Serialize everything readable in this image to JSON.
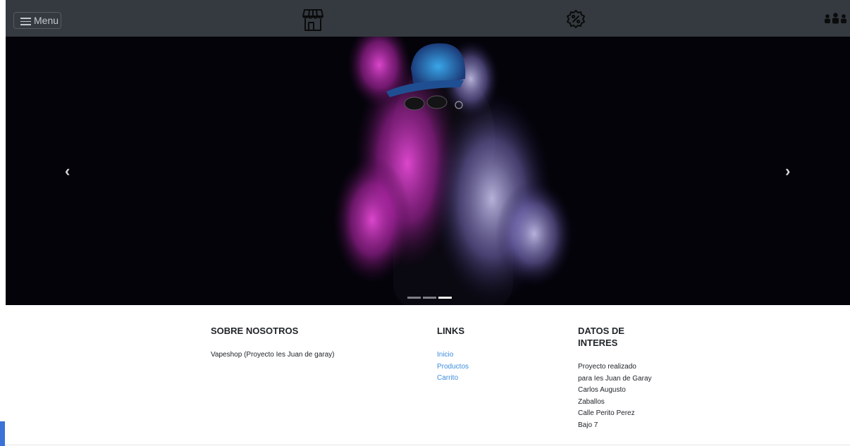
{
  "navbar": {
    "menu_label": "Menu",
    "icons": [
      "store-icon",
      "discount-icon",
      "users-icon"
    ],
    "background": "#343a40"
  },
  "carousel": {
    "prev_label": "‹",
    "next_label": "›",
    "slide_count": 3,
    "active_index": 2
  },
  "footer": {
    "about": {
      "title": "SOBRE NOSOTROS",
      "text": "Vapeshop (Proyecto Ies Juan de garay)"
    },
    "links": {
      "title": "LINKS",
      "items": [
        "Inicio",
        "Productos",
        "Carrito"
      ]
    },
    "info": {
      "title": "DATOS DE INTERES",
      "lines": [
        "Proyecto realizado",
        "para Ies Juan de Garay",
        "Carlos Augusto",
        "Zaballos",
        "Calle Perito Perez",
        "Bajo 7"
      ]
    }
  },
  "colors": {
    "link": "#3c8dde",
    "accent_tab": "#3a72d8"
  }
}
